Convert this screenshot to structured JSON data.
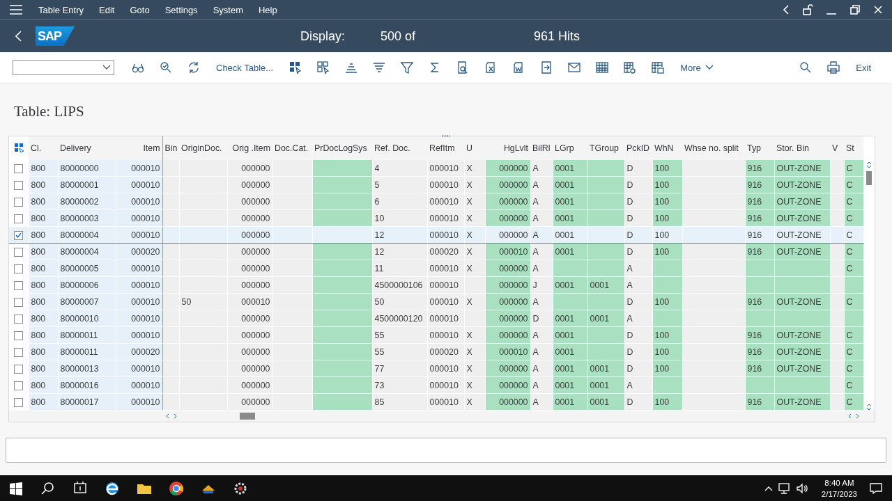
{
  "menu": [
    {
      "label": "Table Entry"
    },
    {
      "label": "Edit"
    },
    {
      "label": "Goto"
    },
    {
      "label": "Settings"
    },
    {
      "label": "System"
    },
    {
      "label": "Help"
    }
  ],
  "title": {
    "logo": "SAP",
    "parts": [
      "Display:",
      "500 of",
      "961 Hits"
    ]
  },
  "toolbar": {
    "check_table": "Check Table...",
    "more": "More",
    "exit": "Exit"
  },
  "heading": "Table: LIPS",
  "table": {
    "columns": [
      {
        "label": "Cl.",
        "kind": "key"
      },
      {
        "label": "Delivery",
        "kind": "key"
      },
      {
        "label": "Item",
        "kind": "key"
      },
      {
        "label": "Bin",
        "kind": "plain"
      },
      {
        "label": "OriginDoc.",
        "kind": "plain"
      },
      {
        "label": "Orig .Item",
        "kind": "plain"
      },
      {
        "label": "Doc.Cat.",
        "kind": "plain"
      },
      {
        "label": "PrDocLogSys",
        "kind": "highlighted"
      },
      {
        "label": "Ref. Doc.",
        "kind": "plain"
      },
      {
        "label": "RefItm",
        "kind": "plain"
      },
      {
        "label": "U",
        "kind": "plain"
      },
      {
        "label": "HgLvlt",
        "kind": "highlighted"
      },
      {
        "label": "BilRl",
        "kind": "plain"
      },
      {
        "label": "LGrp",
        "kind": "highlighted"
      },
      {
        "label": "TGroup",
        "kind": "highlighted"
      },
      {
        "label": "PckID",
        "kind": "plain"
      },
      {
        "label": "WhN",
        "kind": "highlighted"
      },
      {
        "label": "Whse no. split",
        "kind": "plain"
      },
      {
        "label": "Typ",
        "kind": "highlighted"
      },
      {
        "label": "Stor. Bin",
        "kind": "highlighted"
      },
      {
        "label": "V",
        "kind": "plain"
      },
      {
        "label": "St",
        "kind": "highlighted"
      }
    ],
    "rows": [
      {
        "selected": false,
        "checked": false,
        "cells": [
          "800",
          "80000000",
          "000010",
          null,
          null,
          "000000",
          null,
          null,
          "4",
          "000010",
          "X",
          "000000",
          "A",
          "0001",
          null,
          "D",
          "100",
          null,
          "916",
          "OUT-ZONE",
          null,
          "C"
        ]
      },
      {
        "selected": false,
        "checked": false,
        "cells": [
          "800",
          "80000001",
          "000010",
          null,
          null,
          "000000",
          null,
          null,
          "5",
          "000010",
          "X",
          "000000",
          "A",
          "0001",
          null,
          "D",
          "100",
          null,
          "916",
          "OUT-ZONE",
          null,
          "C"
        ]
      },
      {
        "selected": false,
        "checked": false,
        "cells": [
          "800",
          "80000002",
          "000010",
          null,
          null,
          "000000",
          null,
          null,
          "6",
          "000010",
          "X",
          "000000",
          "A",
          "0001",
          null,
          "D",
          "100",
          null,
          "916",
          "OUT-ZONE",
          null,
          "C"
        ]
      },
      {
        "selected": false,
        "checked": false,
        "cells": [
          "800",
          "80000003",
          "000010",
          null,
          null,
          "000000",
          null,
          null,
          "10",
          "000010",
          "X",
          "000000",
          "A",
          "0001",
          null,
          "D",
          "100",
          null,
          "916",
          "OUT-ZONE",
          null,
          "C"
        ]
      },
      {
        "selected": true,
        "checked": true,
        "cells": [
          "800",
          "80000004",
          "000010",
          null,
          null,
          "000000",
          null,
          null,
          "12",
          "000010",
          "X",
          "000000",
          "A",
          "0001",
          null,
          "D",
          "100",
          null,
          "916",
          "OUT-ZONE",
          null,
          "C"
        ]
      },
      {
        "selected": false,
        "checked": false,
        "cells": [
          "800",
          "80000004",
          "000020",
          null,
          null,
          "000000",
          null,
          null,
          "12",
          "000020",
          "X",
          "000010",
          "A",
          "0001",
          null,
          "D",
          "100",
          null,
          "916",
          "OUT-ZONE",
          null,
          "C"
        ]
      },
      {
        "selected": false,
        "checked": false,
        "cells": [
          "800",
          "80000005",
          "000010",
          null,
          null,
          "000000",
          null,
          null,
          "11",
          "000010",
          "X",
          "000000",
          "A",
          null,
          null,
          "A",
          null,
          null,
          null,
          null,
          null,
          "C"
        ]
      },
      {
        "selected": false,
        "checked": false,
        "cells": [
          "800",
          "80000006",
          "000010",
          null,
          null,
          "000000",
          null,
          null,
          "4500000106",
          "000010",
          null,
          "000000",
          "J",
          "0001",
          "0001",
          "A",
          null,
          null,
          null,
          null,
          null,
          null
        ]
      },
      {
        "selected": false,
        "checked": false,
        "cells": [
          "800",
          "80000007",
          "000010",
          null,
          "50",
          "000010",
          null,
          null,
          "50",
          "000010",
          "X",
          "000000",
          "A",
          null,
          null,
          "D",
          "100",
          null,
          "916",
          "OUT-ZONE",
          null,
          "C"
        ]
      },
      {
        "selected": false,
        "checked": false,
        "cells": [
          "800",
          "80000010",
          "000010",
          null,
          null,
          "000000",
          null,
          null,
          "4500000120",
          "000010",
          null,
          "000000",
          "D",
          "0001",
          "0001",
          "A",
          null,
          null,
          null,
          null,
          null,
          null
        ]
      },
      {
        "selected": false,
        "checked": false,
        "cells": [
          "800",
          "80000011",
          "000010",
          null,
          null,
          "000000",
          null,
          null,
          "55",
          "000010",
          "X",
          "000000",
          "A",
          "0001",
          null,
          "D",
          "100",
          null,
          "916",
          "OUT-ZONE",
          null,
          "C"
        ]
      },
      {
        "selected": false,
        "checked": false,
        "cells": [
          "800",
          "80000011",
          "000020",
          null,
          null,
          "000000",
          null,
          null,
          "55",
          "000020",
          "X",
          "000010",
          "A",
          "0001",
          null,
          "D",
          "100",
          null,
          "916",
          "OUT-ZONE",
          null,
          "C"
        ]
      },
      {
        "selected": false,
        "checked": false,
        "cells": [
          "800",
          "80000013",
          "000010",
          null,
          null,
          "000000",
          null,
          null,
          "77",
          "000010",
          "X",
          "000000",
          "A",
          "0001",
          "0001",
          "D",
          "100",
          null,
          "916",
          "OUT-ZONE",
          null,
          "C"
        ]
      },
      {
        "selected": false,
        "checked": false,
        "cells": [
          "800",
          "80000016",
          "000010",
          null,
          null,
          "000000",
          null,
          null,
          "73",
          "000010",
          "X",
          "000000",
          "A",
          "0001",
          "0001",
          "A",
          null,
          null,
          null,
          null,
          null,
          "C"
        ]
      },
      {
        "selected": false,
        "checked": false,
        "cells": [
          "800",
          "80000017",
          "000010",
          null,
          null,
          "000000",
          null,
          null,
          "85",
          "000010",
          "X",
          "000000",
          "A",
          "0001",
          "0001",
          "D",
          "100",
          null,
          "916",
          "OUT-ZONE",
          null,
          "C"
        ]
      }
    ]
  },
  "taskbar": {
    "time": "8:40 AM",
    "date": "2/17/2023"
  }
}
